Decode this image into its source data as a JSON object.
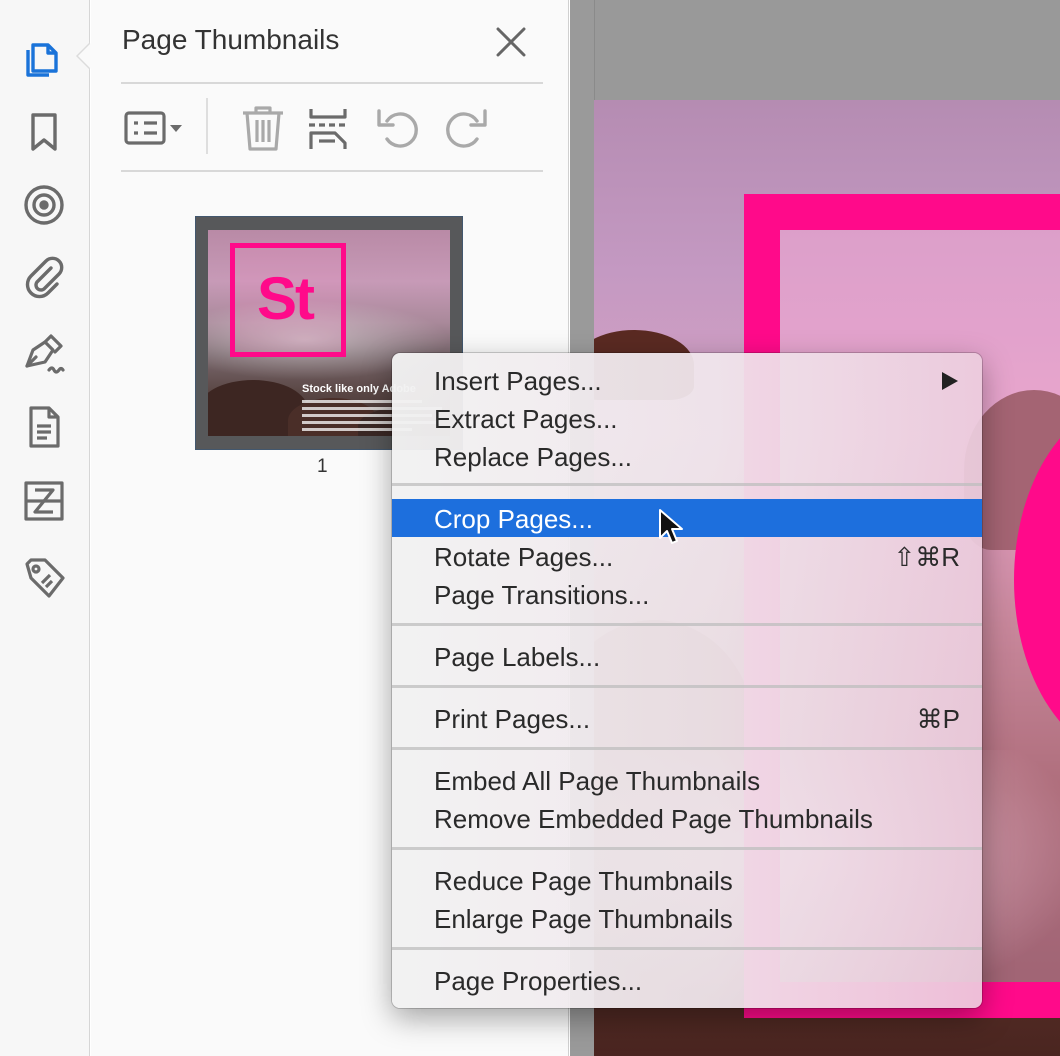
{
  "panel": {
    "title": "Page Thumbnails"
  },
  "thumbnail": {
    "page_number": "1",
    "logo_text": "St",
    "heading": "Stock like only Adobe"
  },
  "context_menu": {
    "items": [
      {
        "label": "Insert Pages...",
        "shortcut": "",
        "submenu": true
      },
      {
        "label": "Extract Pages...",
        "shortcut": ""
      },
      {
        "label": "Replace Pages...",
        "shortcut": ""
      },
      {
        "label": "Crop Pages...",
        "shortcut": "",
        "highlighted": true
      },
      {
        "label": "Rotate Pages...",
        "shortcut": "⇧⌘R"
      },
      {
        "label": "Page Transitions...",
        "shortcut": ""
      },
      {
        "label": "Page Labels...",
        "shortcut": ""
      },
      {
        "label": "Print Pages...",
        "shortcut": "⌘P"
      },
      {
        "label": "Embed All Page Thumbnails",
        "shortcut": ""
      },
      {
        "label": "Remove Embedded Page Thumbnails",
        "shortcut": ""
      },
      {
        "label": "Reduce Page Thumbnails",
        "shortcut": ""
      },
      {
        "label": "Enlarge Page Thumbnails",
        "shortcut": ""
      },
      {
        "label": "Page Properties...",
        "shortcut": ""
      }
    ]
  },
  "colors": {
    "accent_blue": "#1d6fdd",
    "icon_active": "#1a73d9",
    "icon_default": "#6b6b6b",
    "brand_pink": "#ff0a8a"
  },
  "icons": {
    "rail": [
      "page-thumbnails-icon",
      "bookmark-icon",
      "layers-icon",
      "attachment-icon",
      "signature-pen-icon",
      "document-icon",
      "compare-icon",
      "tag-icon"
    ],
    "toolbar": [
      "options-list-icon",
      "trash-icon",
      "insert-pages-icon",
      "rotate-ccw-icon",
      "rotate-cw-icon"
    ]
  }
}
